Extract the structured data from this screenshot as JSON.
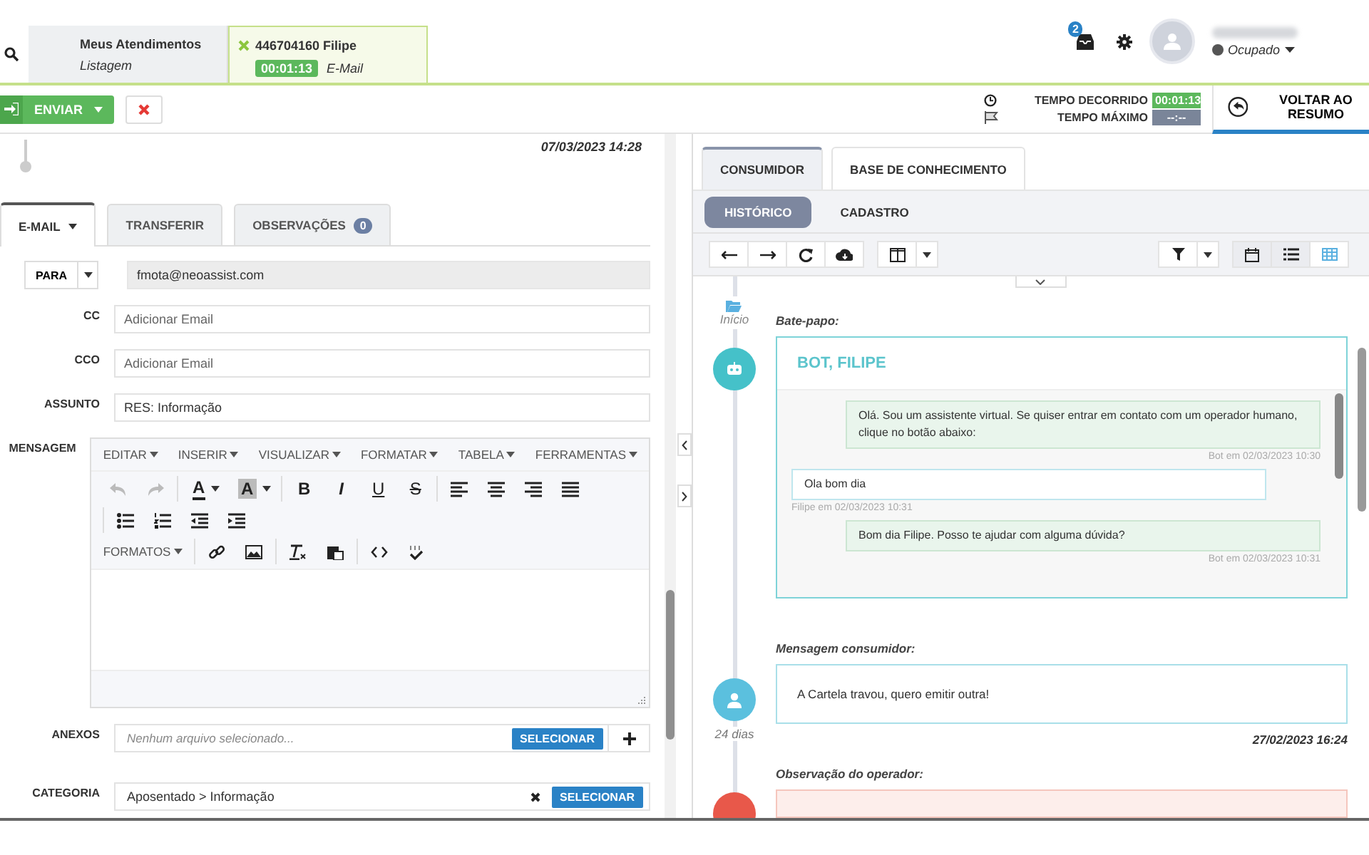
{
  "session_tabs": [
    {
      "title": "Meus Atendimentos",
      "subtitle": "Listagem",
      "selected": false,
      "closable": false
    },
    {
      "title": "446704160 Filipe",
      "timer": "00:01:13",
      "subtitle": "E-Mail",
      "selected": true,
      "closable": true
    }
  ],
  "notifications": {
    "count": "2"
  },
  "user": {
    "status": "Ocupado"
  },
  "send_button": "ENVIAR",
  "timers": [
    {
      "label": "TEMPO DECORRIDO",
      "value": "00:01:13",
      "kind": "elapsed"
    },
    {
      "label": "TEMPO MÁXIMO",
      "value": "--:--",
      "kind": "max"
    }
  ],
  "back_button": "VOLTAR AO RESUMO",
  "compose": {
    "date": "07/03/2023 14:28",
    "tabs": [
      {
        "label": "E-MAIL",
        "selected": true,
        "dropdown": true
      },
      {
        "label": "TRANSFERIR",
        "selected": false,
        "dropdown": false
      },
      {
        "label": "OBSERVAÇÕES",
        "selected": false,
        "dropdown": false,
        "badge": "0"
      }
    ],
    "to": {
      "label": "PARA",
      "value": "fmota@neoassist.com"
    },
    "fields": [
      {
        "label": "CC",
        "placeholder": "Adicionar Email"
      },
      {
        "label": "CCO",
        "placeholder": "Adicionar Email"
      },
      {
        "label": "ASSUNTO",
        "value": "RES: Informação"
      }
    ],
    "message": {
      "label": "MENSAGEM",
      "menus": [
        "EDITAR",
        "INSERIR",
        "VISUALIZAR",
        "FORMATAR",
        "TABELA",
        "FERRAMENTAS"
      ],
      "glyphs": [
        "A",
        "A",
        "B",
        "I",
        "U",
        "S"
      ],
      "formats": "FORMATOS"
    },
    "attachments": {
      "label": "ANEXOS",
      "placeholder": "Nenhum arquivo selecionado...",
      "button": "SELECIONAR"
    },
    "category": {
      "label": "CATEGORIA",
      "value": "Aposentado > Informação",
      "button": "SELECIONAR"
    }
  },
  "consumer": {
    "tabs": [
      {
        "label": "CONSUMIDOR",
        "selected": true
      },
      {
        "label": "BASE DE CONHECIMENTO",
        "selected": false
      }
    ],
    "subtabs": [
      {
        "label": "HISTÓRICO",
        "selected": true
      },
      {
        "label": "CADASTRO",
        "selected": false
      }
    ],
    "views": [
      {
        "selected": false
      },
      {
        "selected": false
      },
      {
        "selected": true
      }
    ],
    "timeline": {
      "start": "Início",
      "events": [
        {
          "kind": "chat",
          "label": "Bate-papo:",
          "title": "BOT, FILIPE",
          "messages": [
            {
              "kind": "bot",
              "text": "Olá. Sou um assistente virtual. Se quiser entrar em contato com um operador humano, clique no botão abaixo:",
              "meta": "Bot em 02/03/2023 10:30"
            },
            {
              "kind": "consumer",
              "text": "Ola bom dia",
              "meta": "Filipe em 02/03/2023 10:31"
            },
            {
              "kind": "bot",
              "text": "Bom dia Filipe. Posso te ajudar com alguma dúvida?",
              "meta": "Bot em 02/03/2023 10:31"
            }
          ]
        },
        {
          "kind": "message",
          "label": "Mensagem consumidor:",
          "text": "A Cartela travou, quero emitir outra!",
          "age": "24 dias",
          "date": "27/02/2023 16:24"
        },
        {
          "kind": "note",
          "label": "Observação do operador:"
        }
      ]
    }
  }
}
